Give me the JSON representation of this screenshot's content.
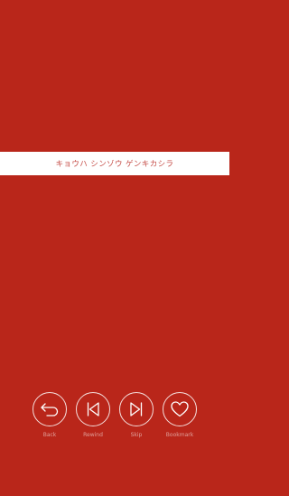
{
  "phrase": {
    "text": "キョウハ シンゾウ ゲンキカシラ"
  },
  "controls": {
    "back": {
      "label": "Back",
      "icon": "back-arrow-icon"
    },
    "rewind": {
      "label": "Rewind",
      "icon": "rewind-icon"
    },
    "skip": {
      "label": "Skip",
      "icon": "skip-icon"
    },
    "bookmark": {
      "label": "Bookmark",
      "icon": "heart-icon"
    }
  },
  "colors": {
    "background": "#b9261a",
    "band": "#ffffff",
    "band_text": "#c44a44",
    "icon": "#ffffff"
  }
}
